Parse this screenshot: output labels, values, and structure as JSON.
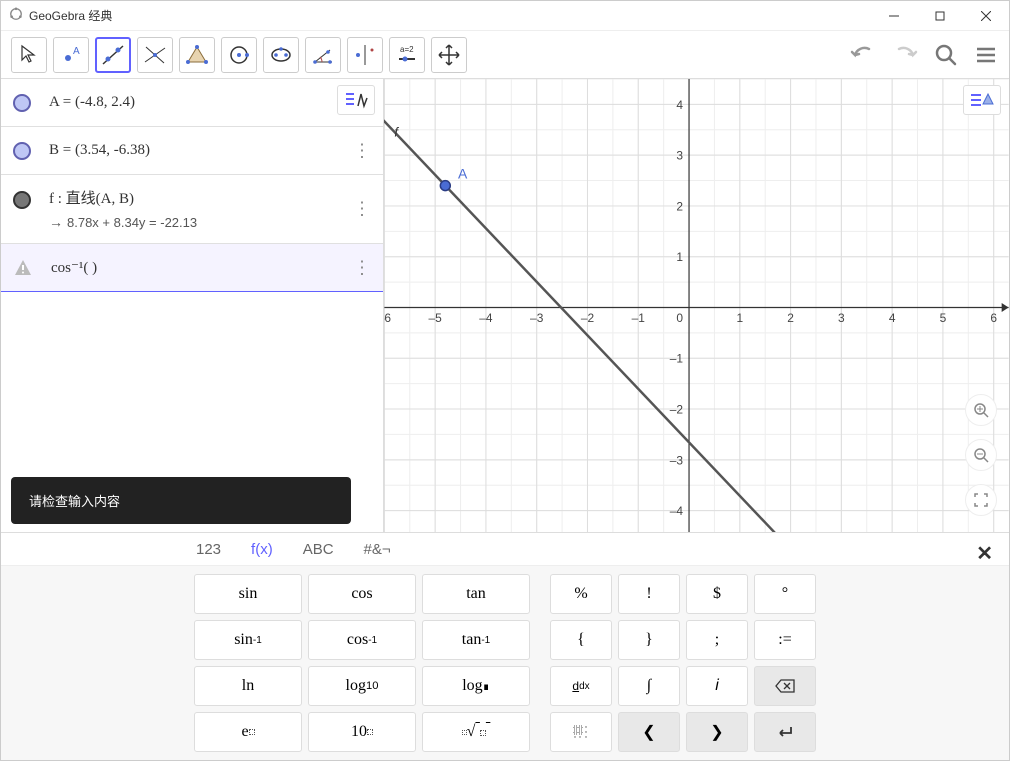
{
  "titlebar": {
    "title": "GeoGebra 经典"
  },
  "algebra": {
    "rowA": "A = (-4.8, 2.4)",
    "rowB": "B = (3.54, -6.38)",
    "rowF_main": "f : 直线(A, B)",
    "rowF_sub": "8.78x + 8.34y = -22.13",
    "rowInput": "cos⁻¹(   )",
    "tooltip": "请检查输入内容"
  },
  "graph": {
    "pointA_label": "A",
    "f_label": "f"
  },
  "keyboard": {
    "tabs": {
      "t1": "123",
      "t2": "f(x)",
      "t3": "ABC",
      "t4": "#&¬"
    },
    "keysA": [
      "sin",
      "cos",
      "tan",
      "sin⁻¹",
      "cos⁻¹",
      "tan⁻¹",
      "ln",
      "log₁₀",
      "logb",
      "eˣ",
      "10ˣ",
      "ⁿ√"
    ],
    "keysB": [
      "%",
      "!",
      "$",
      "°",
      "{",
      "}",
      ";",
      ":=",
      "d/dx",
      "∫",
      "i",
      "⌫",
      "⠿",
      "‹",
      "›",
      "↵"
    ]
  },
  "chart_data": {
    "type": "line",
    "title": "",
    "xlabel": "",
    "ylabel": "",
    "xlim": [
      -6,
      6
    ],
    "ylim": [
      -4.5,
      4.5
    ],
    "grid": true,
    "points": [
      {
        "name": "A",
        "x": -4.8,
        "y": 2.4
      },
      {
        "name": "B",
        "x": 3.54,
        "y": -6.38
      }
    ],
    "series": [
      {
        "name": "f",
        "equation": "8.78x + 8.34y = -22.13",
        "x": [
          -6,
          6
        ],
        "y": [
          4.0,
          -8.97
        ]
      }
    ]
  }
}
